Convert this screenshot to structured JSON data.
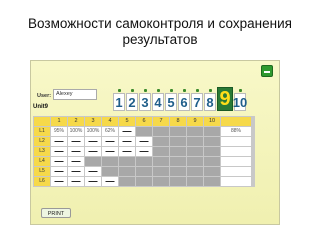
{
  "slide": {
    "title_line1": "Возможности самоконтроля и сохранения",
    "title_line2": "результатов"
  },
  "app": {
    "user_label": "User:",
    "user_name": "Alexey",
    "unit": "Unit9",
    "numbers": [
      "1",
      "2",
      "3",
      "4",
      "5",
      "6",
      "7",
      "8",
      "9",
      "10"
    ],
    "selected_number": "9",
    "print_label": "PRINT",
    "colors": {
      "header": "#f6d94a",
      "locked": "#a8a8a8",
      "accent": "#2a7a36",
      "selected_digit": "#ffde1a"
    }
  },
  "table": {
    "columns": [
      "1",
      "2",
      "3",
      "4",
      "5",
      "6",
      "7",
      "8",
      "9",
      "10"
    ],
    "rows": [
      {
        "label": "L1",
        "cells": [
          "95%",
          "100%",
          "100%",
          "62%",
          "—",
          "",
          "",
          "",
          "",
          ""
        ],
        "score": "88%"
      },
      {
        "label": "L2",
        "cells": [
          "—",
          "—",
          "—",
          "—",
          "—",
          "—",
          "",
          "",
          "",
          ""
        ],
        "score": ""
      },
      {
        "label": "L3",
        "cells": [
          "—",
          "—",
          "—",
          "—",
          "—",
          "—",
          "",
          "",
          "",
          ""
        ],
        "score": ""
      },
      {
        "label": "L4",
        "cells": [
          "—",
          "—",
          "",
          "",
          "",
          "",
          "",
          "",
          "",
          ""
        ],
        "score": ""
      },
      {
        "label": "L5",
        "cells": [
          "—",
          "—",
          "—",
          "",
          "",
          "",
          "",
          "",
          "",
          ""
        ],
        "score": ""
      },
      {
        "label": "L6",
        "cells": [
          "—",
          "—",
          "—",
          "—",
          "",
          "",
          "",
          "",
          "",
          ""
        ],
        "score": ""
      }
    ]
  }
}
